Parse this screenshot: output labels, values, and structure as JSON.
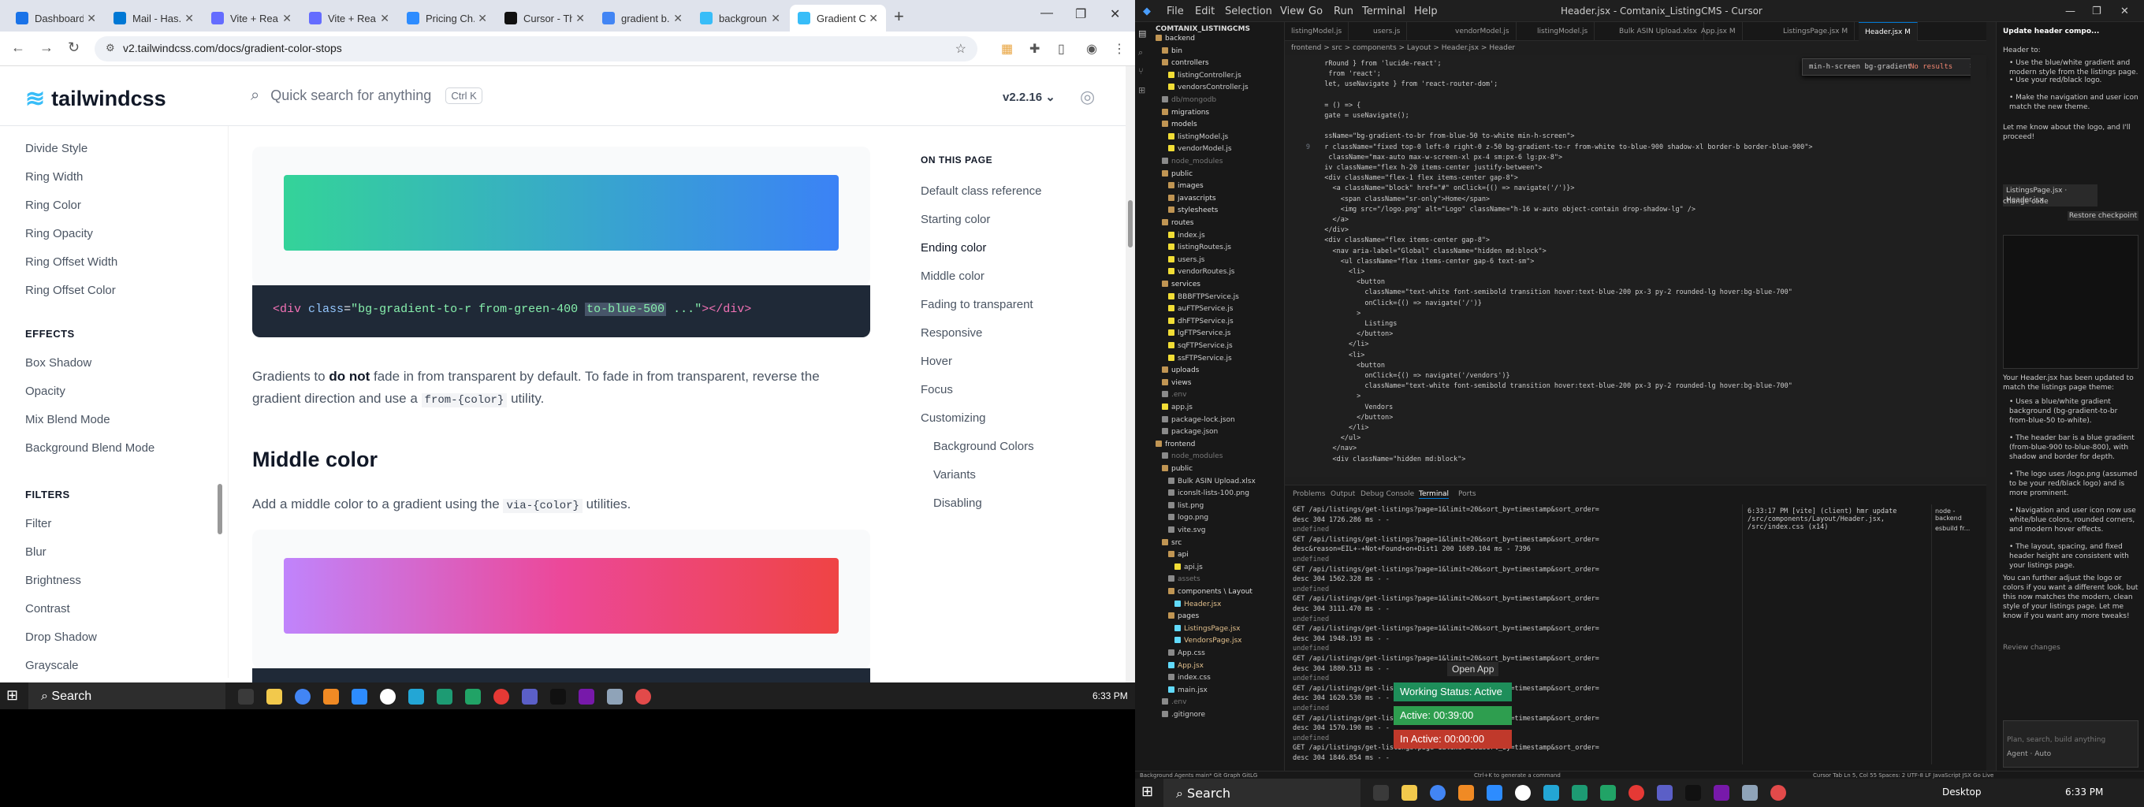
{
  "browser": {
    "tabs": [
      {
        "label": "Dashboard",
        "color": "#1a73e8"
      },
      {
        "label": "Mail - Has...",
        "color": "#0078d4"
      },
      {
        "label": "Vite + Rea...",
        "color": "#646cff"
      },
      {
        "label": "Vite + Rea...",
        "color": "#646cff"
      },
      {
        "label": "Pricing Ch...",
        "color": "#2d8cff"
      },
      {
        "label": "Cursor - Th...",
        "color": "#111111"
      },
      {
        "label": "gradient b...",
        "color": "#4285f4"
      },
      {
        "label": "backgroun...",
        "color": "#38bdf8"
      },
      {
        "label": "Gradient C...",
        "color": "#38bdf8"
      }
    ],
    "url": "v2.tailwindcss.com/docs/gradient-color-stops"
  },
  "site": {
    "logo": "tailwindcss",
    "search_placeholder": "Quick search for anything",
    "search_shortcut": "Ctrl K",
    "version": "v2.2.16"
  },
  "sidebar": {
    "items_top": [
      "Divide Style",
      "Ring Width",
      "Ring Color",
      "Ring Opacity",
      "Ring Offset Width",
      "Ring Offset Color"
    ],
    "effects_heading": "EFFECTS",
    "effects": [
      "Box Shadow",
      "Opacity",
      "Mix Blend Mode",
      "Background Blend Mode"
    ],
    "filters_heading": "FILTERS",
    "filters": [
      "Filter",
      "Blur",
      "Brightness",
      "Contrast",
      "Drop Shadow",
      "Grayscale"
    ]
  },
  "content": {
    "swatch1": {
      "from": "#34d399",
      "to": "#3b82f6"
    },
    "code1": {
      "tag": "div",
      "attr": "class",
      "value_a": "bg-gradient-to-r from-green-400 ",
      "value_hl": "to-blue-500",
      "value_b": " ...",
      "close": "></div>"
    },
    "para1_a": "Gradients to ",
    "para1_b": "do not",
    "para1_c": " fade in from transparent by default. To fade in from transparent, reverse the gradient direction and use a ",
    "para1_code": "from-{color}",
    "para1_d": " utility.",
    "heading_middle": "Middle color",
    "para2_a": "Add a middle color to a gradient using the ",
    "para2_code": "via-{color}",
    "para2_b": " utilities.",
    "swatch2": {
      "from": "#c084fc",
      "via": "#ec4899",
      "to": "#ef4444"
    }
  },
  "on_this_page": {
    "title": "ON THIS PAGE",
    "items": [
      "Default class reference",
      "Starting color",
      "Ending color",
      "Middle color",
      "Fading to transparent",
      "Responsive",
      "Hover",
      "Focus",
      "Customizing"
    ],
    "subitems": [
      "Background Colors",
      "Variants",
      "Disabling"
    ]
  },
  "taskbar": {
    "search": "Search",
    "time": "6:33 PM",
    "desktop": "Desktop"
  },
  "vscode": {
    "menus": [
      "File",
      "Edit",
      "Selection",
      "View",
      "Go",
      "Run",
      "Terminal",
      "Help"
    ],
    "title": "Header.jsx - Comtanix_ListingCMS - Cursor",
    "explorer_title": "COMTANIX_LISTINGCMS",
    "tree": [
      {
        "name": "backend",
        "kind": "d",
        "indent": 0
      },
      {
        "name": "bin",
        "kind": "d",
        "indent": 1
      },
      {
        "name": "controllers",
        "kind": "d",
        "indent": 1
      },
      {
        "name": "listingController.js",
        "kind": "f",
        "indent": 2
      },
      {
        "name": "vendorsController.js",
        "kind": "f",
        "indent": 2
      },
      {
        "name": "db/mongodb",
        "kind": "dim",
        "indent": 1
      },
      {
        "name": "migrations",
        "kind": "d",
        "indent": 1
      },
      {
        "name": "models",
        "kind": "d",
        "indent": 1
      },
      {
        "name": "listingModel.js",
        "kind": "f",
        "indent": 2
      },
      {
        "name": "vendorModel.js",
        "kind": "f",
        "indent": 2
      },
      {
        "name": "node_modules",
        "kind": "dim",
        "indent": 1
      },
      {
        "name": "public",
        "kind": "d",
        "indent": 1
      },
      {
        "name": "images",
        "kind": "d",
        "indent": 2
      },
      {
        "name": "javascripts",
        "kind": "d",
        "indent": 2
      },
      {
        "name": "stylesheets",
        "kind": "d",
        "indent": 2
      },
      {
        "name": "routes",
        "kind": "d",
        "indent": 1
      },
      {
        "name": "index.js",
        "kind": "f",
        "indent": 2
      },
      {
        "name": "listingRoutes.js",
        "kind": "f",
        "indent": 2
      },
      {
        "name": "users.js",
        "kind": "f",
        "indent": 2
      },
      {
        "name": "vendorRoutes.js",
        "kind": "f",
        "indent": 2
      },
      {
        "name": "services",
        "kind": "d",
        "indent": 1
      },
      {
        "name": "BBBFTPService.js",
        "kind": "f",
        "indent": 2
      },
      {
        "name": "auFTPService.js",
        "kind": "f",
        "indent": 2
      },
      {
        "name": "dhFTPService.js",
        "kind": "f",
        "indent": 2
      },
      {
        "name": "lgFTPService.js",
        "kind": "f",
        "indent": 2
      },
      {
        "name": "sqFTPService.js",
        "kind": "f",
        "indent": 2
      },
      {
        "name": "ssFTPService.js",
        "kind": "f",
        "indent": 2
      },
      {
        "name": "uploads",
        "kind": "d",
        "indent": 1
      },
      {
        "name": "views",
        "kind": "d",
        "indent": 1
      },
      {
        "name": ".env",
        "kind": "dim",
        "indent": 1
      },
      {
        "name": "app.js",
        "kind": "f",
        "indent": 1
      },
      {
        "name": "package-lock.json",
        "kind": "f",
        "indent": 1
      },
      {
        "name": "package.json",
        "kind": "f",
        "indent": 1
      },
      {
        "name": "frontend",
        "kind": "d",
        "indent": 0
      },
      {
        "name": "node_modules",
        "kind": "dim",
        "indent": 1
      },
      {
        "name": "public",
        "kind": "d",
        "indent": 1
      },
      {
        "name": "Bulk ASIN Upload.xlsx",
        "kind": "f",
        "indent": 2
      },
      {
        "name": "iconslt-lists-100.png",
        "kind": "f",
        "indent": 2
      },
      {
        "name": "list.png",
        "kind": "f",
        "indent": 2
      },
      {
        "name": "logo.png",
        "kind": "f",
        "indent": 2
      },
      {
        "name": "vite.svg",
        "kind": "f",
        "indent": 2
      },
      {
        "name": "src",
        "kind": "d",
        "indent": 1
      },
      {
        "name": "api",
        "kind": "d",
        "indent": 2
      },
      {
        "name": "api.js",
        "kind": "f",
        "indent": 3
      },
      {
        "name": "assets",
        "kind": "dim",
        "indent": 2
      },
      {
        "name": "components \\ Layout",
        "kind": "d",
        "indent": 2
      },
      {
        "name": "Header.jsx",
        "kind": "m",
        "indent": 3
      },
      {
        "name": "pages",
        "kind": "d",
        "indent": 2
      },
      {
        "name": "ListingsPage.jsx",
        "kind": "m",
        "indent": 3
      },
      {
        "name": "VendorsPage.jsx",
        "kind": "m",
        "indent": 3
      },
      {
        "name": "App.css",
        "kind": "f",
        "indent": 2
      },
      {
        "name": "App.jsx",
        "kind": "m",
        "indent": 2
      },
      {
        "name": "index.css",
        "kind": "f",
        "indent": 2
      },
      {
        "name": "main.jsx",
        "kind": "f",
        "indent": 2
      },
      {
        "name": ".env",
        "kind": "dim",
        "indent": 1
      },
      {
        "name": ".gitignore",
        "kind": "f",
        "indent": 1
      }
    ],
    "editor_tabs": [
      "listingModel.js",
      "users.js",
      "vendorModel.js",
      "listingModel.js",
      "Bulk ASIN Upload.xlsx",
      "App.jsx M",
      "ListingsPage.jsx M",
      "Header.jsx M"
    ],
    "breadcrumb": "frontend > src > components > Layout > Header.jsx > Header",
    "find_text": "min-h-screen bg-gradient",
    "find_result": "No results",
    "code": [
      {
        "n": "",
        "t": "  rRound } from 'lucide-react';"
      },
      {
        "n": "",
        "t": "   from 'react';"
      },
      {
        "n": "",
        "t": "  let, useNavigate } from 'react-router-dom';"
      },
      {
        "n": "",
        "t": ""
      },
      {
        "n": "",
        "t": "  = () => {"
      },
      {
        "n": "",
        "t": "  gate = useNavigate();"
      },
      {
        "n": "",
        "t": ""
      },
      {
        "n": "",
        "t": "  ssName=\"bg-gradient-to-br from-blue-50 to-white min-h-screen\">"
      },
      {
        "n": "9",
        "t": "  r className=\"fixed top-0 left-0 right-0 z-50 bg-gradient-to-r from-white to-blue-900 shadow-xl border-b border-blue-900\">"
      },
      {
        "n": "",
        "t": "   className=\"max-auto max-w-screen-xl px-4 sm:px-6 lg:px-8\">"
      },
      {
        "n": "",
        "t": "  iv className=\"flex h-20 items-center justify-between\">"
      },
      {
        "n": "",
        "t": "  <div className=\"flex-1 flex items-center gap-8\">"
      },
      {
        "n": "",
        "t": "    <a className=\"block\" href=\"#\" onClick={() => navigate('/')}>"
      },
      {
        "n": "",
        "t": "      <span className=\"sr-only\">Home</span>"
      },
      {
        "n": "",
        "t": "      <img src=\"/logo.png\" alt=\"Logo\" className=\"h-16 w-auto object-contain drop-shadow-lg\" />"
      },
      {
        "n": "",
        "t": "    </a>"
      },
      {
        "n": "",
        "t": "  </div>"
      },
      {
        "n": "",
        "t": "  <div className=\"flex items-center gap-8\">"
      },
      {
        "n": "",
        "t": "    <nav aria-label=\"Global\" className=\"hidden md:block\">"
      },
      {
        "n": "",
        "t": "      <ul className=\"flex items-center gap-6 text-sm\">"
      },
      {
        "n": "",
        "t": "        <li>"
      },
      {
        "n": "",
        "t": "          <button"
      },
      {
        "n": "",
        "t": "            className=\"text-white font-semibold transition hover:text-blue-200 px-3 py-2 rounded-lg hover:bg-blue-700\""
      },
      {
        "n": "",
        "t": "            onClick={() => navigate('/')}"
      },
      {
        "n": "",
        "t": "          >"
      },
      {
        "n": "",
        "t": "            Listings"
      },
      {
        "n": "",
        "t": "          </button>"
      },
      {
        "n": "",
        "t": "        </li>"
      },
      {
        "n": "",
        "t": "        <li>"
      },
      {
        "n": "",
        "t": "          <button"
      },
      {
        "n": "",
        "t": "            onClick={() => navigate('/vendors')}"
      },
      {
        "n": "",
        "t": "            className=\"text-white font-semibold transition hover:text-blue-200 px-3 py-2 rounded-lg hover:bg-blue-700\""
      },
      {
        "n": "",
        "t": "          >"
      },
      {
        "n": "",
        "t": "            Vendors"
      },
      {
        "n": "",
        "t": "          </button>"
      },
      {
        "n": "",
        "t": "        </li>"
      },
      {
        "n": "",
        "t": "      </ul>"
      },
      {
        "n": "",
        "t": "    </nav>"
      },
      {
        "n": "",
        "t": "    <div className=\"hidden md:block\">"
      }
    ],
    "panel_tabs": [
      "Problems",
      "Output",
      "Debug Console",
      "Terminal",
      "Ports"
    ],
    "terminal": [
      "GET /api/listings/get-listings?page=1&limit=20&sort_by=timestamp&sort_order=",
      "desc 304 1726.286 ms - -",
      "undefined",
      "GET /api/listings/get-listings?page=1&limit=20&sort_by=timestamp&sort_order=",
      "desc&reason=EIL+-+Not+Found+on+Dist1 200 1689.104 ms - 7396",
      "undefined",
      "GET /api/listings/get-listings?page=1&limit=20&sort_by=timestamp&sort_order=",
      "desc 304 1562.328 ms - -",
      "undefined",
      "GET /api/listings/get-listings?page=1&limit=20&sort_by=timestamp&sort_order=",
      "desc 304 3111.470 ms - -",
      "undefined",
      "GET /api/listings/get-listings?page=1&limit=20&sort_by=timestamp&sort_order=",
      "desc 304 1948.193 ms - -",
      "undefined",
      "GET /api/listings/get-listings?page=1&limit=20&sort_by=timestamp&sort_order=",
      "desc 304 1880.513 ms - -",
      "undefined",
      "GET /api/listings/get-listings?page=1&limit=20&sort_by=timestamp&sort_order=",
      "desc 304 1620.530 ms - -",
      "undefined",
      "GET /api/listings/get-listings?page=1&limit=20&sort_by=timestamp&sort_order=",
      "desc 304 1570.190 ms - -",
      "undefined",
      "GET /api/listings/get-listings?page=1&limit=20&sort_by=timestamp&sort_order=",
      "desc 304 1846.854 ms - -"
    ],
    "terminal2": "6:33:17 PM [vite] (client) hmr update /src/components/Layout/Header.jsx, /src/index.css (x14)",
    "term_sessions": [
      "node - backend",
      "esbuild fr..."
    ],
    "chat": {
      "title": "Update header compo...",
      "intro": "Header to:",
      "bullets1": [
        "Use the blue/white gradient and modern style from the listings page.",
        "Use your red/black logo.",
        "Make the navigation and user icon match the new theme."
      ],
      "ask": "Let me know about the logo, and I'll proceed!",
      "file_chip_a": "ListingsPage.jsx",
      "file_chip_b": "Header.jsx",
      "change_code": "change code",
      "restore": "Restore checkpoint",
      "summary": "Your Header.jsx has been updated to match the listings page theme:",
      "bullets2": [
        "Uses a blue/white gradient background (bg-gradient-to-br from-blue-50 to-white).",
        "The header bar is a blue gradient (from-blue-900 to-blue-800), with shadow and border for depth.",
        "The logo uses /logo.png (assumed to be your red/black logo) and is more prominent.",
        "Navigation and user icon now use white/blue colors, rounded corners, and modern hover effects.",
        "The layout, spacing, and fixed header height are consistent with your listings page."
      ],
      "closing": "You can further adjust the logo or colors if you want a different look, but this now matches the modern, clean style of your listings page. Let me know if you want any more tweaks!",
      "review": "Review changes",
      "input_placeholder": "Plan, search, build anything",
      "mode": "Agent",
      "model": "Auto"
    },
    "workstatus": {
      "open": "Open App",
      "working": "Working Status: Active",
      "active": "Active: 00:39:00",
      "inactive": "In Active: 00:00:00",
      "working_color": "#1e8e5a",
      "active_color": "#2e9e4f",
      "inactive_color": "#c0392b"
    },
    "status": {
      "left": "Background Agents   main*   Git Graph   GitLG",
      "middle": "Ctrl+K to generate a command",
      "right": "Cursor Tab   Ln 5, Col 55   Spaces: 2   UTF-8   LF   JavaScript JSX   Go Live"
    }
  }
}
